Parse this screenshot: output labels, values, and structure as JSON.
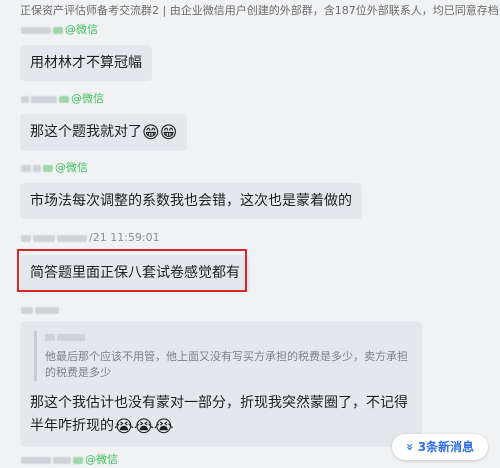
{
  "header": {
    "title": "正保资产评估师备考交流群2 | 由企业微信用户创建的外部群，含187位外部联系人，均已同意存档会"
  },
  "messages": [
    {
      "sender_suffix": "@微信",
      "text": "用材林才不算冠幅",
      "emoji": ""
    },
    {
      "sender_suffix": "@微信",
      "text": "那这个题我就对了",
      "emoji": "😁😁"
    },
    {
      "sender_suffix": "@微信",
      "text": "市场法每次调整的系数我也会错，这次也是蒙着做的",
      "emoji": ""
    },
    {
      "sender_suffix": "/21 11:59:01",
      "text": "简答题里面正保八套试卷感觉都有",
      "emoji": ""
    },
    {
      "quote_text": "他最后那个应该不用管，他上面又没有写买方承担的税费是多少，卖方承担的税费是多少",
      "text": "那这个我估计也没有蒙对一部分，折现我突然蒙圈了，不记得半年咋折现的",
      "emoji": "😭😭😭"
    },
    {
      "sender_suffix": "@微信",
      "text": "",
      "emoji": ""
    }
  ],
  "new_messages_button": {
    "icon": "»",
    "label": "3条新消息"
  },
  "colors": {
    "highlight": "#d9262b",
    "accent": "#2f6fe6",
    "wechat": "#3bbf5b"
  }
}
